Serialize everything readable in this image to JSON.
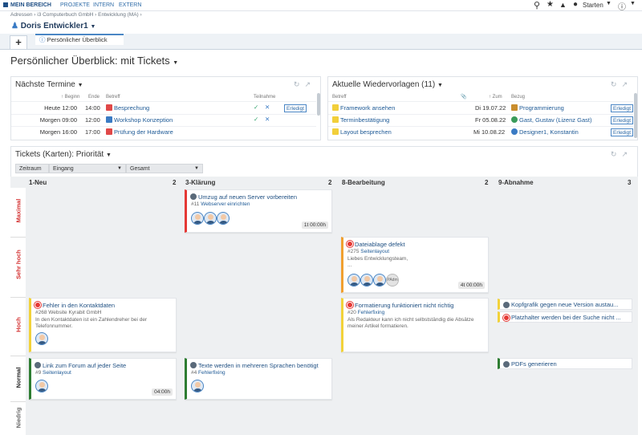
{
  "nav": {
    "items": [
      "MEIN BEREICH",
      "PROJEKTE",
      "INTERN",
      "EXTERN"
    ],
    "start_label": "Starten"
  },
  "breadcrumb": [
    "Adressen",
    "i3 Computerbuch GmbH",
    "Entwicklung (MA)"
  ],
  "user": "Doris Entwickler1",
  "tab": {
    "add": "+",
    "label": "Persönlicher Überblick"
  },
  "page_title": "Persönlicher Überblick: mit Tickets",
  "termine": {
    "title": "Nächste Termine",
    "headers": [
      "Beginn",
      "Ende",
      "Betreff",
      "Teilnahme"
    ],
    "rows": [
      {
        "begin": "Heute 12:00",
        "end": "14:00",
        "subject": "Besprechung",
        "action": "Erledigt"
      },
      {
        "begin": "Morgen 09:00",
        "end": "12:00",
        "subject": "Workshop Konzeption",
        "action": ""
      },
      {
        "begin": "Morgen 16:00",
        "end": "17:00",
        "subject": "Prüfung der Hardware",
        "action": ""
      }
    ]
  },
  "wv": {
    "title": "Aktuelle Wiedervorlagen (11)",
    "headers": [
      "Betreff",
      "Zum",
      "Bezug"
    ],
    "rows": [
      {
        "subject": "Framework ansehen",
        "date": "Di 19.07.22",
        "ref": "Programmierung",
        "action": "Erledigt"
      },
      {
        "subject": "Terminbestätigung",
        "date": "Fr 05.08.22",
        "ref": "Gast, Gustav (Lizenz Gast)",
        "action": "Erledigt"
      },
      {
        "subject": "Layout besprechen",
        "date": "Mi 10.08.22",
        "ref": "Designer1, Konstantin",
        "action": "Erledigt"
      }
    ]
  },
  "tickets": {
    "title": "Tickets (Karten): Priorität",
    "filters": {
      "zeitraum": "Zeitraum",
      "eingang": "Eingang",
      "gesamt": "Gesamt"
    },
    "columns": [
      {
        "name": "1-Neu",
        "count": "2"
      },
      {
        "name": "3-Klärung",
        "count": "2"
      },
      {
        "name": "8-Bearbeitung",
        "count": "2"
      },
      {
        "name": "9-Abnahme",
        "count": "3"
      }
    ],
    "rows": [
      "Maximal",
      "Sehr hoch",
      "Hoch",
      "Normal",
      "Niedrig"
    ],
    "cards": {
      "c1": {
        "title": "Umzug auf neuen Server vorbereiten",
        "id": "#11",
        "project": "Webserver einrichten",
        "duration": "1t 00:00h"
      },
      "c2": {
        "title": "Dateiablage defekt",
        "id": "#275",
        "project": "Seitenlayout",
        "desc": "Liebes Entwicklungsteam,",
        "ellipsis": "...",
        "duration": "4t 00:00h",
        "extra": "PAdm"
      },
      "c3": {
        "title": "Fehler in den Kontaktdaten",
        "id": "#268",
        "project": "Website Kyrabit GmbH",
        "desc": "In den Kontaktdaten ist ein Zahlendreher bei der Telefonnummer."
      },
      "c4": {
        "title": "Formatierung funktioniert nicht richtig",
        "id": "#20",
        "project": "Fehlerfixing",
        "desc": "Als Redakteur kann ich nicht selbstständig die Absätze meiner Artikel formatieren."
      },
      "c5": {
        "title": "Kopfgrafik gegen neue Version austau..."
      },
      "c6": {
        "title": "Platzhalter werden bei der Suche nicht ..."
      },
      "c7": {
        "title": "Link zum Forum auf jeder Seite",
        "id": "#9",
        "project": "Seitenlayout",
        "duration": "04:00h"
      },
      "c8": {
        "title": "Texte werden in mehreren Sprachen benötigt",
        "id": "#4",
        "project": "Fehlerfixing"
      },
      "c9": {
        "title": "PDFs generieren"
      }
    }
  }
}
